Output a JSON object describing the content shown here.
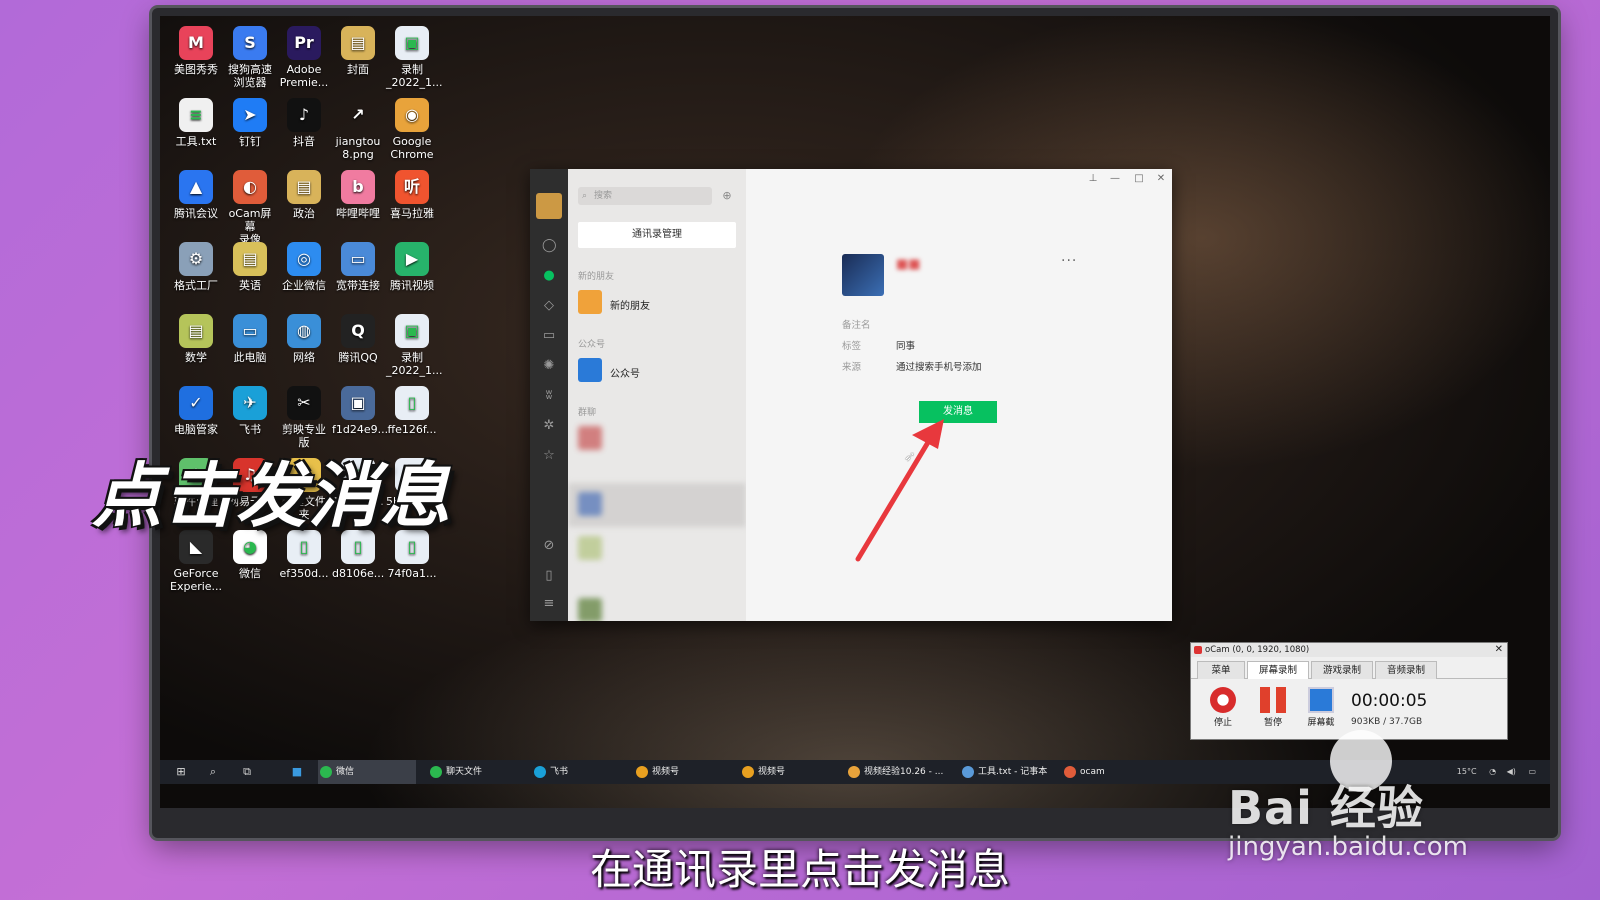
{
  "desktop": {
    "icons": [
      {
        "label": "美图秀秀",
        "color": "#e8435a",
        "glyph": "M"
      },
      {
        "label": "搜狗高速\n浏览器",
        "color": "#3a7bf0",
        "glyph": "S"
      },
      {
        "label": "Adobe\nPremie...",
        "color": "#2a1a5e",
        "glyph": "Pr"
      },
      {
        "label": "封面",
        "color": "#d8b35a",
        "glyph": "▤"
      },
      {
        "label": "录制\n_2022_1...",
        "color": "#e8eef5",
        "glyph": "▣"
      },
      {
        "label": "工具.txt",
        "color": "#f0f0f0",
        "glyph": "≡"
      },
      {
        "label": "钉钉",
        "color": "#1f7cf5",
        "glyph": "➤"
      },
      {
        "label": "抖音",
        "color": "#111111",
        "glyph": "♪"
      },
      {
        "label": "jiangtou\n8.png",
        "color": "transparent",
        "glyph": "↗"
      },
      {
        "label": "Google\nChrome",
        "color": "#e8a33b",
        "glyph": "◉"
      },
      {
        "label": "腾讯会议",
        "color": "#2a75f0",
        "glyph": "▲"
      },
      {
        "label": "oCam屏幕\n录像",
        "color": "#e05c3a",
        "glyph": "◐"
      },
      {
        "label": "政治",
        "color": "#d8b35a",
        "glyph": "▤"
      },
      {
        "label": "哔哩哔哩",
        "color": "#f07ba0",
        "glyph": "b"
      },
      {
        "label": "喜马拉雅",
        "color": "#f0542f",
        "glyph": "听"
      },
      {
        "label": "格式工厂",
        "color": "#8aa0b8",
        "glyph": "⚙"
      },
      {
        "label": "英语",
        "color": "#d8c05a",
        "glyph": "▤"
      },
      {
        "label": "企业微信",
        "color": "#2d8cf0",
        "glyph": "◎"
      },
      {
        "label": "宽带连接",
        "color": "#4a8ad8",
        "glyph": "▭"
      },
      {
        "label": "腾讯视频",
        "color": "#27b36b",
        "glyph": "▶"
      },
      {
        "label": "数学",
        "color": "#b5c45a",
        "glyph": "▤"
      },
      {
        "label": "此电脑",
        "color": "#3a8fd8",
        "glyph": "▭"
      },
      {
        "label": "网络",
        "color": "#3a8fd8",
        "glyph": "◍"
      },
      {
        "label": "腾讯QQ",
        "color": "#222222",
        "glyph": "Q"
      },
      {
        "label": "录制\n_2022_1...",
        "color": "#e8eef5",
        "glyph": "▣"
      },
      {
        "label": "电脑管家",
        "color": "#1f6fe0",
        "glyph": "✓"
      },
      {
        "label": "飞书",
        "color": "#1aa0d8",
        "glyph": "✈"
      },
      {
        "label": "剪映专业\n版",
        "color": "#111111",
        "glyph": "✂"
      },
      {
        "label": "f1d24e9...",
        "color": "#4a6a9a",
        "glyph": "▣"
      },
      {
        "label": "ffe126f...",
        "color": "#e8eef5",
        "glyph": "▯"
      },
      {
        "label": "软件管理",
        "color": "#5fc06b",
        "glyph": "✿"
      },
      {
        "label": "网易云音\n乐",
        "color": "#d8342c",
        "glyph": "♫"
      },
      {
        "label": "新建文件\n夹",
        "color": "#e8c04a",
        "glyph": "▤"
      },
      {
        "label": "1c0470...",
        "color": "#e8eef5",
        "glyph": "▯"
      },
      {
        "label": "5be639...",
        "color": "#e8eef5",
        "glyph": "▯"
      },
      {
        "label": "GeForce\nExperie...",
        "color": "#2a2a2a",
        "glyph": "◣"
      },
      {
        "label": "微信",
        "color": "#ffffff",
        "glyph": "◕"
      },
      {
        "label": "ef350d...",
        "color": "#e8eef5",
        "glyph": "▯"
      },
      {
        "label": "d8106e...",
        "color": "#e8eef5",
        "glyph": "▯"
      },
      {
        "label": "74f0a1...",
        "color": "#e8eef5",
        "glyph": "▯"
      }
    ]
  },
  "wechat": {
    "search_placeholder": "搜索",
    "manage_contacts": "通讯录管理",
    "section_new_friends": "新的朋友",
    "item_new_friends": "新的朋友",
    "section_official": "公众号",
    "item_official": "公众号",
    "section_groups": "群聊",
    "contact": {
      "remark_label": "备注名",
      "tag_label": "标签",
      "tag_value": "同事",
      "source_label": "来源",
      "source_value": "通过搜索手机号添加",
      "send_button": "发消息"
    },
    "more_glyph": "···",
    "window_controls": [
      "⊥",
      "—",
      "□",
      "✕"
    ]
  },
  "taskbar": {
    "apps": [
      {
        "label": "微信",
        "color": "#2bb84f",
        "active": true
      },
      {
        "label": "聊天文件",
        "color": "#2bb84f",
        "active": false
      },
      {
        "label": "飞书",
        "color": "#1aa0d8",
        "active": false
      },
      {
        "label": "视频号",
        "color": "#e8a020",
        "active": false
      },
      {
        "label": "视频号",
        "color": "#e8a020",
        "active": false
      },
      {
        "label": "视频经验10.26 - ...",
        "color": "#e8a33b",
        "active": false
      },
      {
        "label": "工具.txt - 记事本",
        "color": "#5a9ad8",
        "active": false
      },
      {
        "label": "ocam",
        "color": "#e05c3a",
        "active": false
      }
    ],
    "tray_temp": "15°C"
  },
  "ocam": {
    "title": "oCam (0, 0, 1920, 1080)",
    "tabs": [
      "菜单",
      "屏幕录制",
      "游戏录制",
      "音频录制"
    ],
    "stop_label": "停止",
    "pause_label": "暂停",
    "screen_label": "屏幕截",
    "timer": "00:00:05",
    "size": "903KB / 37.7GB"
  },
  "overlay": {
    "title": "点击发消息",
    "subtitle": "在通讯录里点击发消息"
  },
  "watermark": {
    "logo": "Bai 经验",
    "url": "jingyan.baidu.com"
  },
  "colors": {
    "wechat_green": "#07c160",
    "arrow_red": "#e8383d"
  }
}
